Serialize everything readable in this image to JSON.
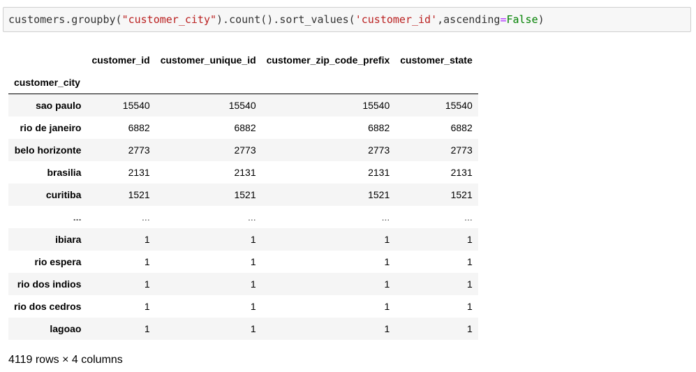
{
  "code": {
    "prefix": "customers.groupby(",
    "arg1": "\"customer_city\"",
    "middle": ").count().sort_values(",
    "arg2": "'customer_id'",
    "param": ",ascending",
    "equals": "=",
    "value": "False",
    "suffix": ")"
  },
  "table": {
    "columns": [
      "customer_id",
      "customer_unique_id",
      "customer_zip_code_prefix",
      "customer_state"
    ],
    "index_name": "customer_city",
    "rows": [
      {
        "index": "sao paulo",
        "values": [
          "15540",
          "15540",
          "15540",
          "15540"
        ]
      },
      {
        "index": "rio de janeiro",
        "values": [
          "6882",
          "6882",
          "6882",
          "6882"
        ]
      },
      {
        "index": "belo horizonte",
        "values": [
          "2773",
          "2773",
          "2773",
          "2773"
        ]
      },
      {
        "index": "brasilia",
        "values": [
          "2131",
          "2131",
          "2131",
          "2131"
        ]
      },
      {
        "index": "curitiba",
        "values": [
          "1521",
          "1521",
          "1521",
          "1521"
        ]
      },
      {
        "index": "...",
        "values": [
          "...",
          "...",
          "...",
          "..."
        ]
      },
      {
        "index": "ibiara",
        "values": [
          "1",
          "1",
          "1",
          "1"
        ]
      },
      {
        "index": "rio espera",
        "values": [
          "1",
          "1",
          "1",
          "1"
        ]
      },
      {
        "index": "rio dos indios",
        "values": [
          "1",
          "1",
          "1",
          "1"
        ]
      },
      {
        "index": "rio dos cedros",
        "values": [
          "1",
          "1",
          "1",
          "1"
        ]
      },
      {
        "index": "lagoao",
        "values": [
          "1",
          "1",
          "1",
          "1"
        ]
      }
    ]
  },
  "summary": "4119 rows × 4 columns"
}
